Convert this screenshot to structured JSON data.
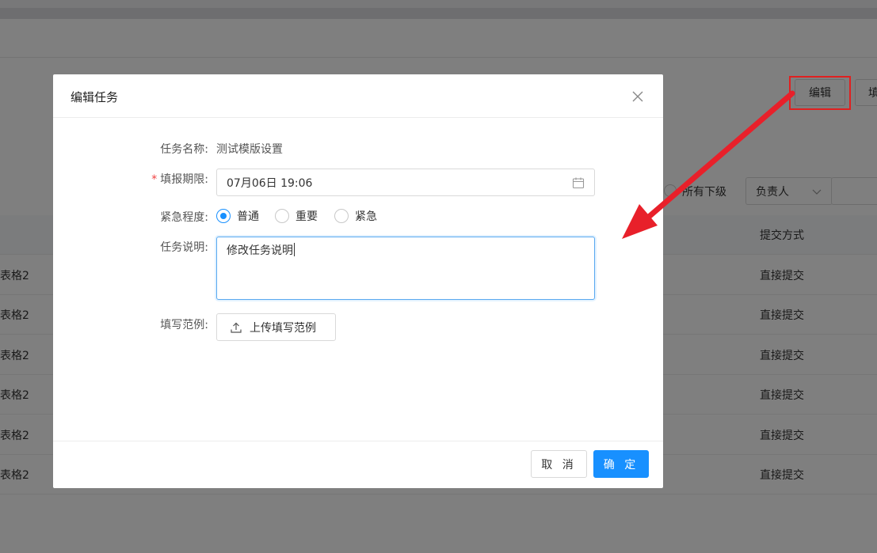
{
  "background": {
    "edit_button": "编辑",
    "fill_button": "填",
    "filter_radio_label": "所有下级",
    "owner_select": "负责人",
    "table_header_submit": "提交方式",
    "rows": [
      {
        "left": "表格2",
        "right": "直接提交"
      },
      {
        "left": "表格2",
        "right": "直接提交"
      },
      {
        "left": "表格2",
        "right": "直接提交"
      },
      {
        "left": "表格2",
        "right": "直接提交"
      },
      {
        "left": "表格2",
        "right": "直接提交"
      },
      {
        "left": "表格2",
        "right": "直接提交"
      }
    ]
  },
  "dialog": {
    "title": "编辑任务",
    "task_name_label": "任务名称:",
    "task_name_value": "测试模版设置",
    "deadline_required_mark": "*",
    "deadline_label": "填报期限:",
    "deadline_value": "07月06日 19:06",
    "urgency_label": "紧急程度:",
    "urgency_options": [
      {
        "label": "普通",
        "checked": true
      },
      {
        "label": "重要",
        "checked": false
      },
      {
        "label": "紧急",
        "checked": false
      }
    ],
    "description_label": "任务说明:",
    "description_value": "修改任务说明",
    "example_label": "填写范例:",
    "upload_button": "上传填写范例",
    "cancel_button": "取 消",
    "confirm_button": "确 定"
  },
  "colors": {
    "primary": "#1890ff",
    "annotation_red": "#e02020",
    "required": "#f04040"
  },
  "icons": [
    "close-icon",
    "calendar-icon",
    "upload-icon",
    "chevron-down-icon",
    "annotation-arrow"
  ]
}
